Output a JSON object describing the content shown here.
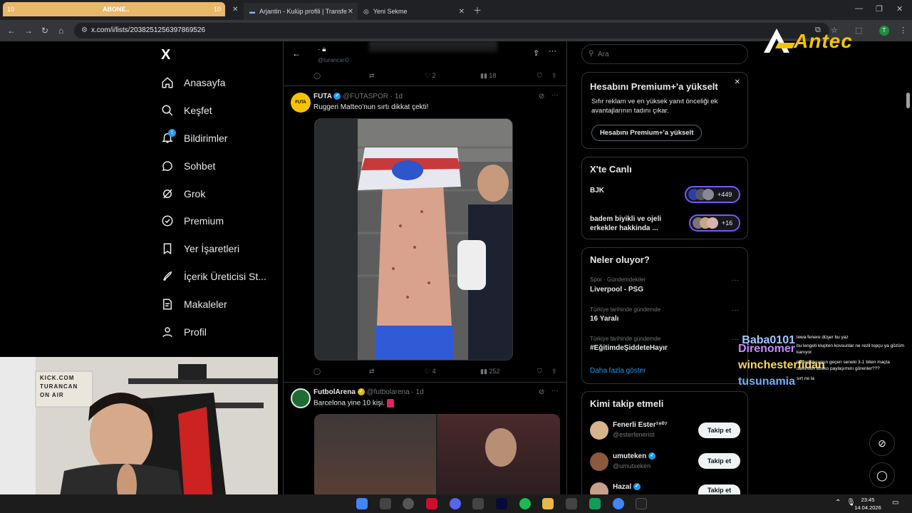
{
  "browser": {
    "tabs": [
      {
        "label": "ABONE..",
        "count_left": "10",
        "count_right": "10"
      },
      {
        "label": "Arjantin - Kulüp profili | Transfe"
      },
      {
        "label": "Yeni Sekme"
      }
    ],
    "url": "x.com/i/lists/2038251256397869526"
  },
  "brand": {
    "logo_text": "Antec"
  },
  "nav": {
    "logo": "X",
    "items": [
      {
        "label": "Anasayfa"
      },
      {
        "label": "Keşfet"
      },
      {
        "label": "Bildirimler",
        "badge": "1"
      },
      {
        "label": "Sohbet"
      },
      {
        "label": "Grok"
      },
      {
        "label": "Premium"
      },
      {
        "label": "Yer İşaretleri"
      },
      {
        "label": "İçerik Üreticisi St..."
      },
      {
        "label": "Makaleler"
      },
      {
        "label": "Profil"
      }
    ]
  },
  "feed": {
    "top_post": {
      "handle": "@turancan0",
      "stats": {
        "likes": "2",
        "views": "18"
      }
    },
    "posts": [
      {
        "avatar_text": "FUTA",
        "name": "FUTA",
        "handle": "@FUTASPOR",
        "time": "1d",
        "text": "Ruggeri Matteo'nun sırtı dikkat çekti!",
        "stats": {
          "likes": "4",
          "views": "252"
        }
      },
      {
        "name": "FutbolArena",
        "handle": "@futbolarena",
        "time": "1d",
        "text": "Barcelona yine 10 kişi."
      }
    ]
  },
  "sidebar": {
    "search_placeholder": "Ara",
    "premium": {
      "title": "Hesabını Premium+'a yükselt",
      "body": "Sıfır reklam ve en yüksek yanıt önceliği ek avantajlarının tadını çıkar.",
      "button": "Hesabını Premium+'a yükselt"
    },
    "live": {
      "title": "X'te Canlı",
      "items": [
        {
          "label": "BJK",
          "count": "+449"
        },
        {
          "label": "badem biyikli ve ojeli erkekler hakkinda ...",
          "count": "+16"
        }
      ]
    },
    "trends": {
      "title": "Neler oluyor?",
      "items": [
        {
          "category": "Spor · Gündemdekiler",
          "name": "Liverpool - PSG"
        },
        {
          "category": "Türkiye tarihinde gündemde",
          "name": "16 Yaralı"
        },
        {
          "category": "Türkiye tarihinde gündemde",
          "name": "#EğitimdeŞiddeteHayır"
        }
      ],
      "more": "Daha fazla göster"
    },
    "who_to_follow": {
      "title": "Kimi takip etmeli",
      "items": [
        {
          "name": "Fenerli Ester¹⁹⁰⁷",
          "handle": "@esterfenerist",
          "button": "Takip et"
        },
        {
          "name": "umuteken",
          "handle": "@umutxeken",
          "button": "Takip et"
        },
        {
          "name": "Hazal",
          "handle": "",
          "button": "Takip et"
        }
      ]
    }
  },
  "chat": [
    {
      "user": "Baba0101",
      "color": "#a0c8ff",
      "msg": "lewa fenere düşer bu yaz"
    },
    {
      "user": "Direnomer",
      "color": "#c58cff",
      "msg": "bu lengeti klupten kovsunlar ne rezil topçu ya gözüm kanıyor"
    },
    {
      "user": "winchesterfidan",
      "color": "#ffd84d",
      "msg": "ndvan aksunun geçen seneki 3-1 biten maçta davinson dzeko paylaşımını görenler???"
    },
    {
      "user": "tusunamia",
      "color": "#6ab0ff",
      "msg": "sırt ne la"
    }
  ],
  "webcam": {
    "sign_text": "KICK.COM TURANCAN ON AIR"
  },
  "taskbar": {
    "time": "23:45",
    "date": "14.04.2026"
  }
}
